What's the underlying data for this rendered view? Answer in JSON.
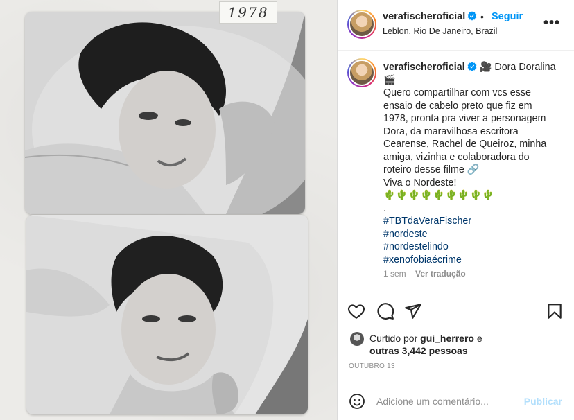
{
  "media": {
    "year_label": "1978"
  },
  "header": {
    "username": "verafischeroficial",
    "separator": "•",
    "follow_label": "Seguir",
    "location": "Leblon, Rio De Janeiro, Brazil",
    "more_label": "•••"
  },
  "caption": {
    "username": "verafischeroficial",
    "lines": [
      "🎥 Dora Doralina",
      "🎬",
      "Quero compartilhar com vcs esse",
      "ensaio de cabelo preto que fiz em",
      "1978, pronta pra viver a personagem",
      "Dora, da maravilhosa escritora",
      "Cearense, Rachel de Queiroz, minha",
      "amiga, vizinha e colaboradora do",
      "roteiro desse filme 🔗",
      "Viva o Nordeste!",
      "🌵🌵🌵🌵🌵🌵🌵🌵🌵",
      "."
    ],
    "hashtags": [
      "#TBTdaVeraFischer",
      "#nordeste",
      "#nordestelindo",
      "#xenofobiaécrime"
    ],
    "time_ago": "1 sem",
    "translate_label": "Ver tradução"
  },
  "likes": {
    "prefix": "Curtido por ",
    "user": "gui_herrero",
    "middle": " e",
    "others": "outras 3,442 pessoas"
  },
  "date": "OUTUBRO 13",
  "comment": {
    "placeholder": "Adicione um comentário...",
    "publish_label": "Publicar"
  },
  "colors": {
    "accent": "#0095f6",
    "hashtag": "#00376b",
    "publish_disabled": "#b2dffc",
    "muted": "#8e8e8e"
  },
  "icons": [
    "heart-icon",
    "comment-icon",
    "share-icon",
    "bookmark-icon",
    "emoji-icon",
    "verified-icon"
  ]
}
